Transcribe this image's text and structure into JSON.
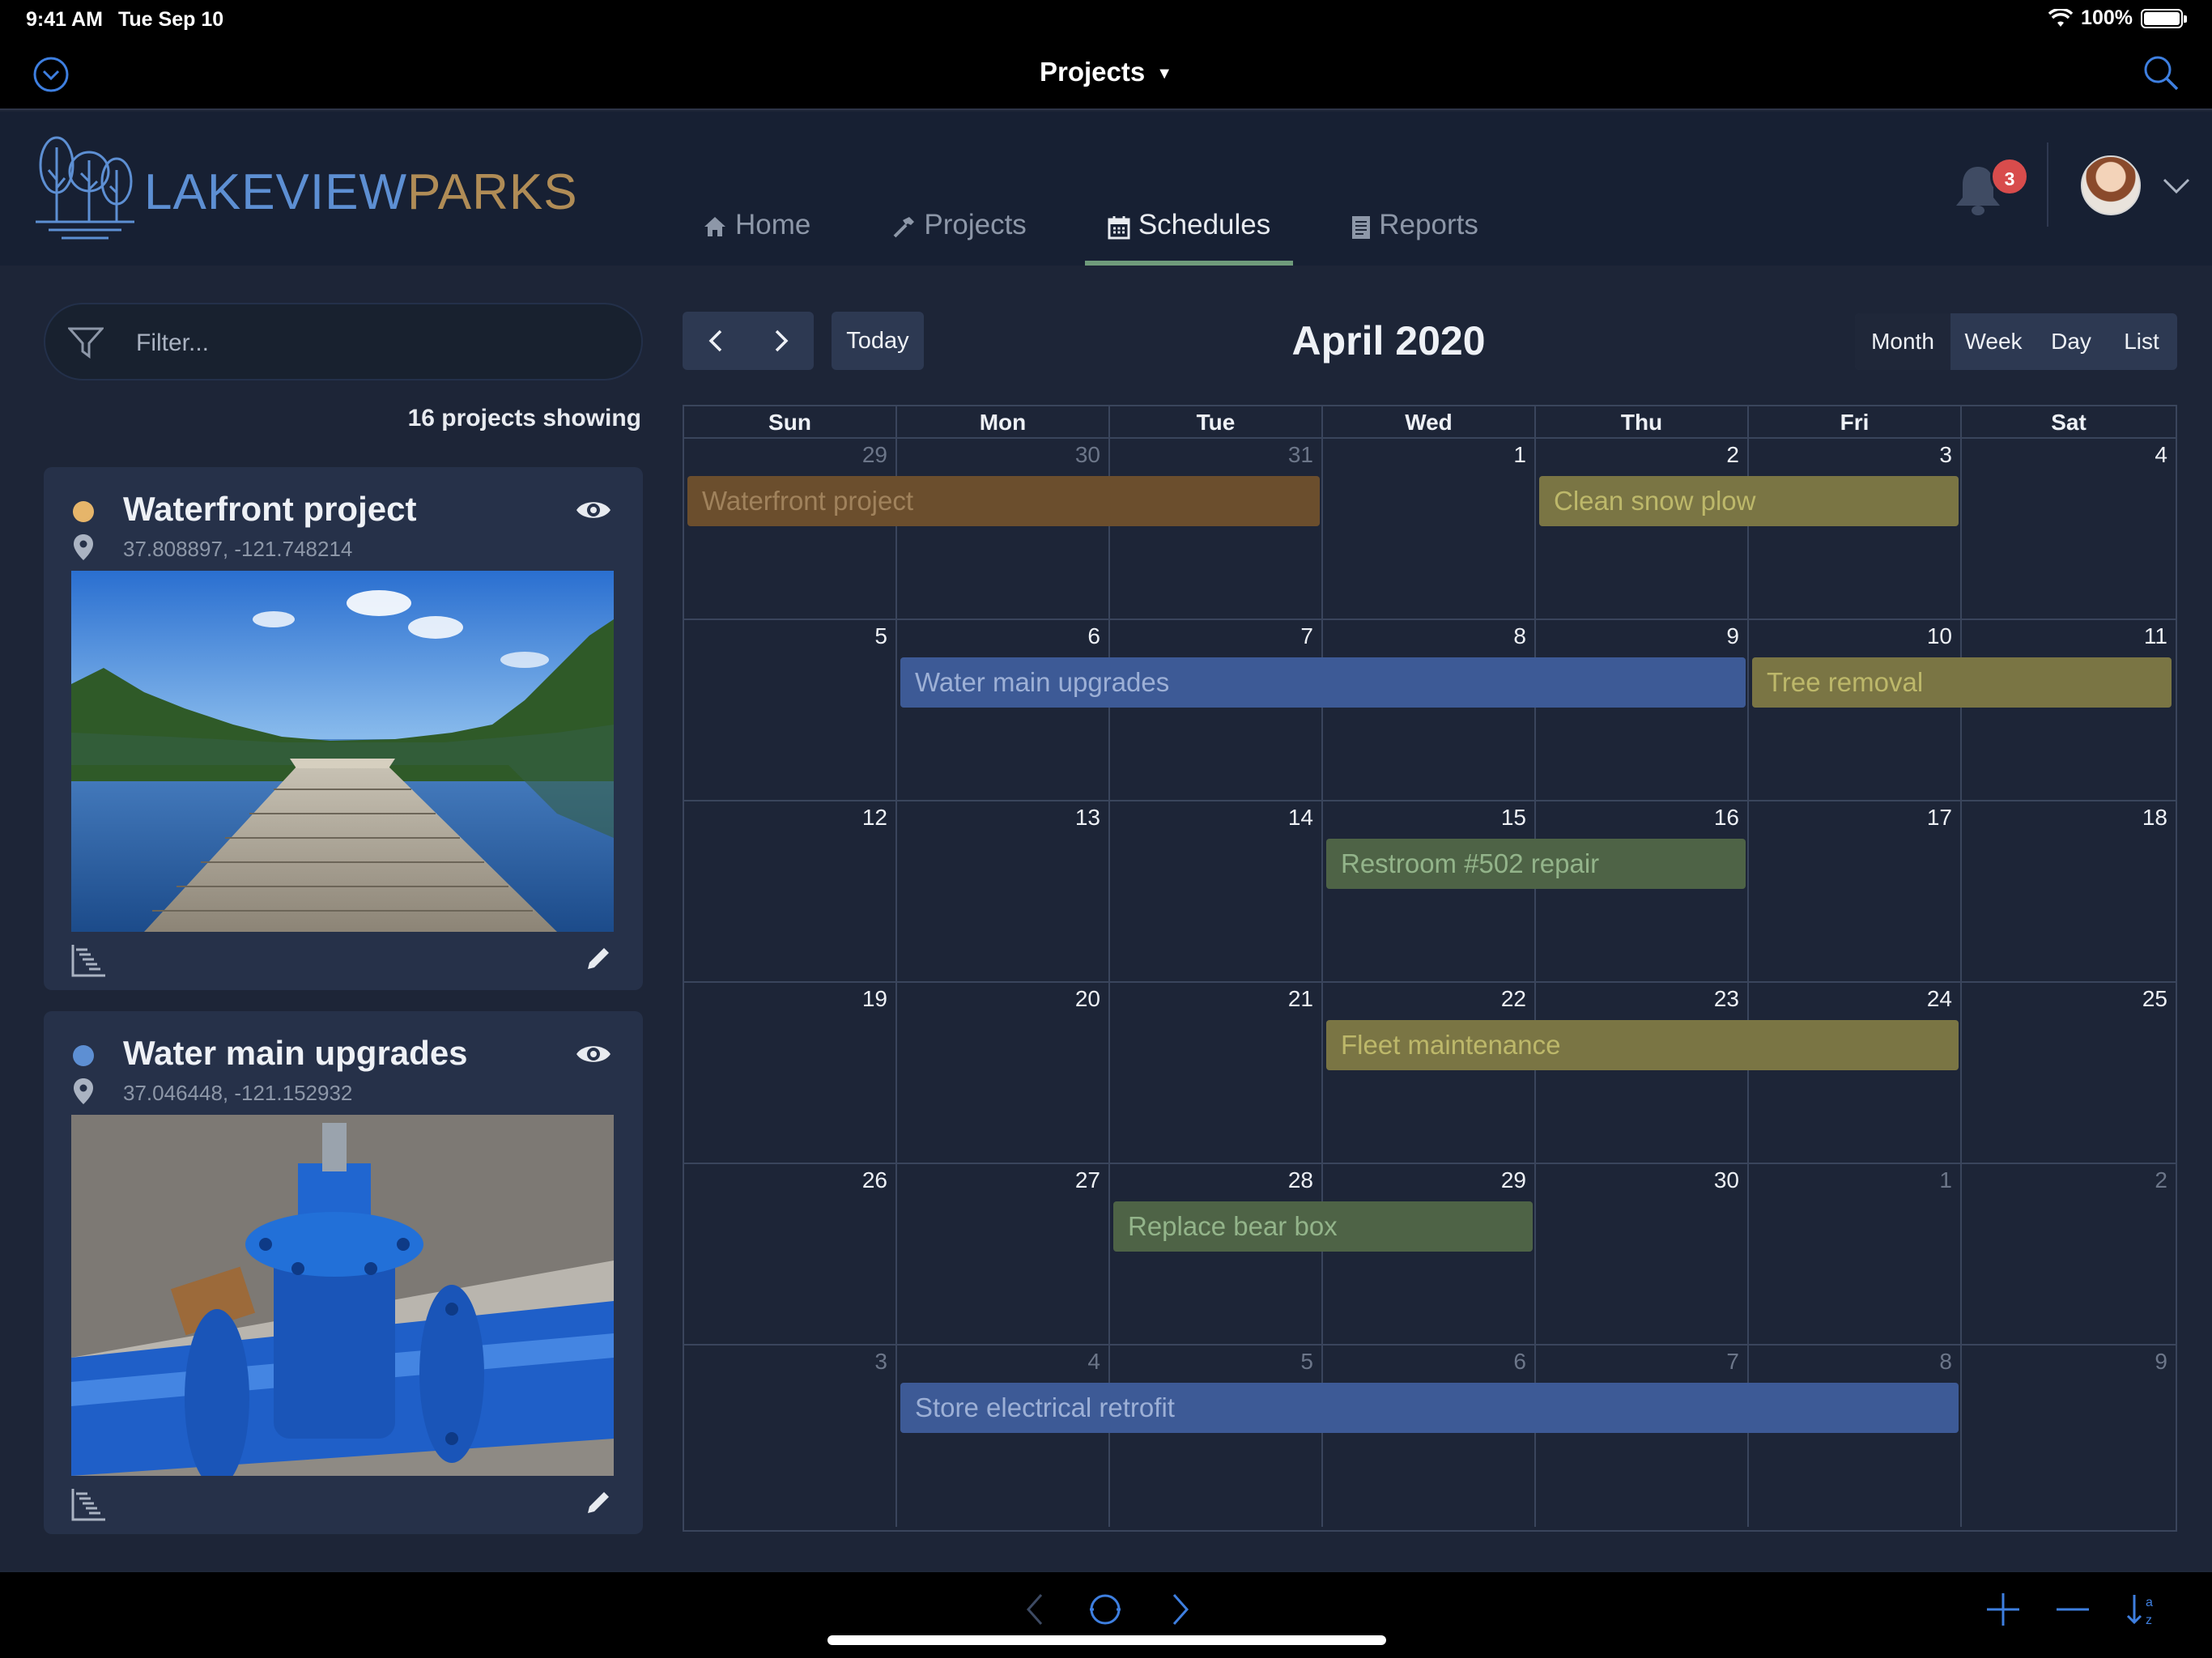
{
  "status": {
    "time": "9:41 AM",
    "date": "Tue Sep 10",
    "battery": "100%"
  },
  "navbar": {
    "title": "Projects",
    "left_icon": "chevron-circle-down-icon",
    "right_icon": "search-icon"
  },
  "brand": {
    "name_part1": "LAKEVIEW",
    "name_part2": "PARKS",
    "color1": "#5d8fd3",
    "color2": "#b08c56"
  },
  "tabs": [
    {
      "label": "Home",
      "icon": "home-icon"
    },
    {
      "label": "Projects",
      "icon": "hammer-icon"
    },
    {
      "label": "Schedules",
      "icon": "calendar-icon",
      "active": true
    },
    {
      "label": "Reports",
      "icon": "document-icon"
    }
  ],
  "notifications": {
    "count": "3"
  },
  "sidebar": {
    "filter_placeholder": "Filter...",
    "count_text": "16 projects showing",
    "projects": [
      {
        "name": "Waterfront project",
        "coords": "37.808897, -121.748214",
        "color": "#e6b56a"
      },
      {
        "name": "Water main upgrades",
        "coords": "37.046448, -121.152932",
        "color": "#5d8fd3"
      }
    ]
  },
  "calendar": {
    "title": "April 2020",
    "today_label": "Today",
    "views": [
      "Month",
      "Week",
      "Day",
      "List"
    ],
    "active_view": "Month",
    "weekdays": [
      "Sun",
      "Mon",
      "Tue",
      "Wed",
      "Thu",
      "Fri",
      "Sat"
    ],
    "weeks": [
      [
        {
          "d": "29",
          "m": true
        },
        {
          "d": "30",
          "m": true
        },
        {
          "d": "31",
          "m": true
        },
        {
          "d": "1"
        },
        {
          "d": "2"
        },
        {
          "d": "3"
        },
        {
          "d": "4"
        }
      ],
      [
        {
          "d": "5"
        },
        {
          "d": "6"
        },
        {
          "d": "7"
        },
        {
          "d": "8"
        },
        {
          "d": "9"
        },
        {
          "d": "10"
        },
        {
          "d": "11"
        }
      ],
      [
        {
          "d": "12"
        },
        {
          "d": "13"
        },
        {
          "d": "14"
        },
        {
          "d": "15"
        },
        {
          "d": "16"
        },
        {
          "d": "17"
        },
        {
          "d": "18"
        }
      ],
      [
        {
          "d": "19"
        },
        {
          "d": "20"
        },
        {
          "d": "21"
        },
        {
          "d": "22"
        },
        {
          "d": "23"
        },
        {
          "d": "24"
        },
        {
          "d": "25"
        }
      ],
      [
        {
          "d": "26"
        },
        {
          "d": "27"
        },
        {
          "d": "28"
        },
        {
          "d": "29"
        },
        {
          "d": "30"
        },
        {
          "d": "1",
          "m": true
        },
        {
          "d": "2",
          "m": true
        }
      ],
      [
        {
          "d": "3",
          "m": true
        },
        {
          "d": "4",
          "m": true
        },
        {
          "d": "5",
          "m": true
        },
        {
          "d": "6",
          "m": true
        },
        {
          "d": "7",
          "m": true
        },
        {
          "d": "8",
          "m": true
        },
        {
          "d": "9",
          "m": true
        }
      ]
    ],
    "events": [
      {
        "label": "Waterfront project",
        "week": 0,
        "start": 0,
        "span": 3,
        "color": "brown"
      },
      {
        "label": "Clean snow plow",
        "week": 0,
        "start": 4,
        "span": 2,
        "color": "yellow"
      },
      {
        "label": "Water main upgrades",
        "week": 1,
        "start": 1,
        "span": 4,
        "color": "blue"
      },
      {
        "label": "Tree removal",
        "week": 1,
        "start": 5,
        "span": 2,
        "color": "yellow"
      },
      {
        "label": "Restroom #502 repair",
        "week": 2,
        "start": 3,
        "span": 2,
        "color": "green"
      },
      {
        "label": "Fleet maintenance",
        "week": 3,
        "start": 3,
        "span": 3,
        "color": "yellow"
      },
      {
        "label": "Replace bear box",
        "week": 4,
        "start": 2,
        "span": 2,
        "color": "green"
      },
      {
        "label": "Store electrical retrofit",
        "week": 5,
        "start": 1,
        "span": 5,
        "color": "blue"
      }
    ]
  }
}
